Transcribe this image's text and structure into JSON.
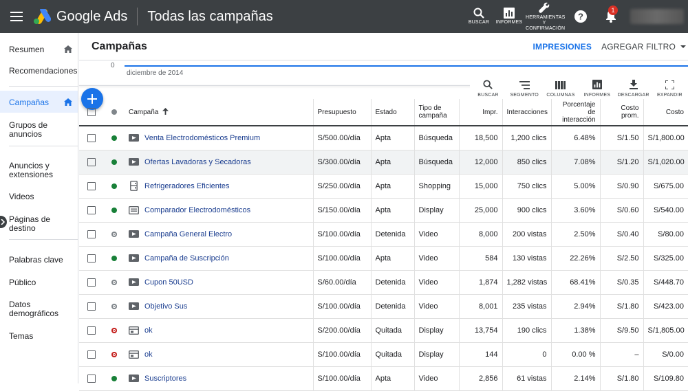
{
  "topbar": {
    "app_name": "Google Ads",
    "page_title": "Todas las campañas",
    "actions": [
      {
        "label": "BUSCAR",
        "icon": "search-icon"
      },
      {
        "label": "INFORMES",
        "icon": "reports-icon"
      },
      {
        "label": "HERRAMIENTAS Y CONFIRMACIÓN",
        "icon": "wrench-icon"
      }
    ],
    "notification_count": "1"
  },
  "sidebar": {
    "items": [
      {
        "label": "Resumen",
        "home": true
      },
      {
        "label": "Recomendaciones"
      },
      {
        "label": "Campañas",
        "home": true,
        "active": true
      },
      {
        "label": "Grupos de anuncios"
      },
      {
        "label": "Anuncios y extensiones"
      },
      {
        "label": "Videos"
      },
      {
        "label": "Páginas de destino"
      },
      {
        "label": "Palabras clave"
      },
      {
        "label": "Público"
      },
      {
        "label": "Datos demográficos"
      },
      {
        "label": "Temas"
      }
    ]
  },
  "main": {
    "title": "Campañas",
    "impressions_label": "IMPRESIONES",
    "filter_label": "AGREGAR FILTRO",
    "chart_zero": "0",
    "chart_date": "diciembre de 2014",
    "toolbar": [
      {
        "label": "BUSCAR",
        "icon": "search-icon"
      },
      {
        "label": "SEGMENTO",
        "icon": "segment-icon"
      },
      {
        "label": "COLUMNAS",
        "icon": "columns-icon"
      },
      {
        "label": "INFORMES",
        "icon": "reports-icon"
      },
      {
        "label": "DESCARGAR",
        "icon": "download-icon"
      },
      {
        "label": "EXPANDIR",
        "icon": "fullscreen-icon"
      }
    ]
  },
  "table": {
    "headers": {
      "campaign": "Campaña",
      "budget": "Presupuesto",
      "status": "Estado",
      "type": "Tipo de campaña",
      "impr": "Impr.",
      "interactions": "Interacciones",
      "rate": "Porcentaje de interacción",
      "avg_cost": "Costo prom.",
      "cost": "Costo"
    },
    "rows": [
      {
        "status_dot": "green",
        "type_icon": "video-icon",
        "name": "Venta Electrodomésticos Premium",
        "budget": "S/500.00/día",
        "status": "Apta",
        "status_color": "normal",
        "type": "Búsqueda",
        "impr": "18,500",
        "interactions": "1,200 clics",
        "rate": "6.48%",
        "avg_cost": "S/1.50",
        "cost": "S/1,800.00"
      },
      {
        "status_dot": "green",
        "type_icon": "video-icon",
        "name": "Ofertas Lavadoras y Secadoras",
        "budget": "S/300.00/día",
        "status": "Apta",
        "status_color": "normal",
        "type": "Búsqueda",
        "impr": "12,000",
        "interactions": "850 clics",
        "rate": "7.08%",
        "avg_cost": "S/1.20",
        "cost": "S/1,020.00",
        "highlight": true
      },
      {
        "status_dot": "green",
        "type_icon": "shopping-icon",
        "name": "Refrigeradores Eficientes",
        "budget": "S/250.00/día",
        "status": "Apta",
        "status_color": "normal",
        "type": "Shopping",
        "impr": "15,000",
        "interactions": "750 clics",
        "rate": "5.00%",
        "avg_cost": "S/0.90",
        "cost": "S/675.00"
      },
      {
        "status_dot": "green",
        "type_icon": "display-icon",
        "name": "Comparador Electrodomésticos",
        "budget": "S/150.00/día",
        "status": "Apta",
        "status_color": "normal",
        "type": "Display",
        "impr": "25,000",
        "interactions": "900 clics",
        "rate": "3.60%",
        "avg_cost": "S/0.60",
        "cost": "S/540.00"
      },
      {
        "status_dot": "gray",
        "type_icon": "video-icon",
        "name": "Campaña General Electro",
        "budget": "S/100.00/día",
        "status": "Detenida",
        "status_color": "red",
        "type": "Video",
        "impr": "8,000",
        "interactions": "200 vistas",
        "rate": "2.50%",
        "avg_cost": "S/0.40",
        "cost": "S/80.00"
      },
      {
        "status_dot": "green",
        "type_icon": "video-icon",
        "name": "Campaña de Suscripción",
        "budget": "S/100.00/día",
        "status": "Apta",
        "status_color": "normal",
        "type": "Video",
        "impr": "584",
        "interactions": "130 vistas",
        "rate": "22.26%",
        "avg_cost": "S/2.50",
        "cost": "S/325.00"
      },
      {
        "status_dot": "gray",
        "type_icon": "video-icon",
        "name": "Cupon 50USD",
        "budget": "S/60.00/día",
        "status": "Detenida",
        "status_color": "red",
        "type": "Video",
        "impr": "1,874",
        "interactions": "1,282 vistas",
        "rate": "68.41%",
        "avg_cost": "S/0.35",
        "cost": "S/448.70"
      },
      {
        "status_dot": "gray",
        "type_icon": "video-icon",
        "name": "Objetivo Sus",
        "budget": "S/100.00/día",
        "status": "Detenida",
        "status_color": "red",
        "type": "Video",
        "impr": "8,001",
        "interactions": "235 vistas",
        "rate": "2.94%",
        "avg_cost": "S/1.80",
        "cost": "S/423.00"
      },
      {
        "status_dot": "red",
        "type_icon": "display-ad-icon",
        "name": "ok",
        "budget": "S/200.00/día",
        "status": "Quitada",
        "status_color": "red",
        "type": "Display",
        "impr": "13,754",
        "interactions": "190 clics",
        "rate": "1.38%",
        "avg_cost": "S/9.50",
        "cost": "S/1,805.00"
      },
      {
        "status_dot": "red",
        "type_icon": "display-ad-icon",
        "name": "ok",
        "budget": "S/100.00/día",
        "status": "Quitada",
        "status_color": "red",
        "type": "Display",
        "impr": "144",
        "interactions": "0",
        "rate": "0.00 %",
        "avg_cost": "–",
        "cost": "S/0.00"
      },
      {
        "status_dot": "green",
        "type_icon": "video-icon",
        "name": "Suscriptores",
        "budget": "S/100.00/día",
        "status": "Apta",
        "status_color": "normal",
        "type": "Video",
        "impr": "2,856",
        "interactions": "61 vistas",
        "rate": "2.14%",
        "avg_cost": "S/1.80",
        "cost": "S/109.80"
      }
    ]
  },
  "colors": {
    "topbar_bg": "#3c4043",
    "accent_blue": "#1a73e8",
    "link_blue": "#1a3d8f",
    "status_green": "#188038",
    "status_red": "#c5221f",
    "status_gray": "#80868b"
  }
}
